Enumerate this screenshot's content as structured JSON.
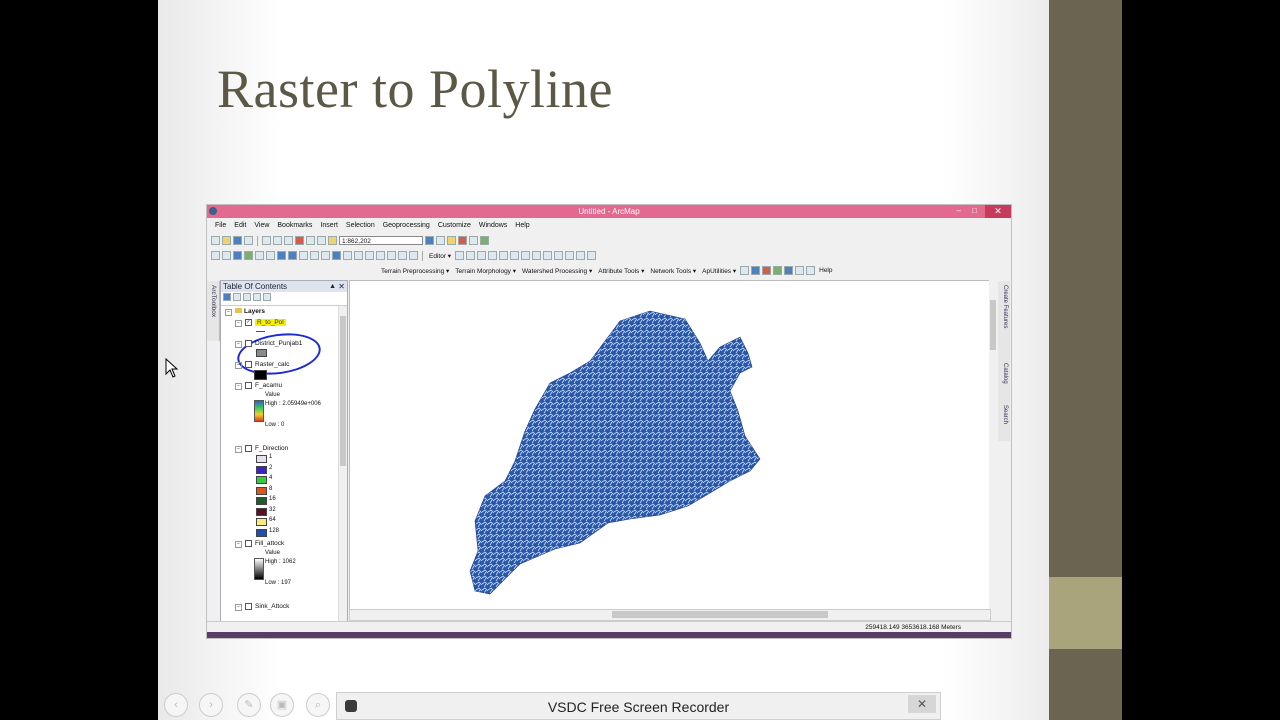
{
  "slide": {
    "title": "Raster to Polyline",
    "accent_color": "#6b6450",
    "accent_light": "#a9a47c",
    "title_color": "#5b5845"
  },
  "arcmap": {
    "window_title": "Untitled - ArcMap",
    "titlebar_color": "#e36a8e",
    "menu": [
      "File",
      "Edit",
      "View",
      "Bookmarks",
      "Insert",
      "Selection",
      "Geoprocessing",
      "Customize",
      "Windows",
      "Help"
    ],
    "scale_value": "1:862,202",
    "editor_label": "Editor ▾",
    "toolbar3": [
      "Terrain Preprocessing ▾",
      "Terrain Morphology ▾",
      "Watershed Processing ▾",
      "Attribute Tools ▾",
      "Network Tools ▾",
      "ApUtilities ▾",
      "Help"
    ],
    "left_tab": "ArcToolbox",
    "right_tabs": [
      "Create Features",
      "Catalog",
      "Search"
    ],
    "toc": {
      "title": "Table Of Contents",
      "root": "Layers",
      "layers": [
        {
          "name": "R_to_Pol",
          "checked": true
        },
        {
          "name": "District_Punjab1",
          "checked": false
        },
        {
          "name": "Raster_calc",
          "checked": false
        },
        {
          "name": "F_acamu",
          "checked": false,
          "value_label": "Value",
          "high": "High : 2.05949e+006",
          "low": "Low : 0"
        },
        {
          "name": "F_Direction",
          "checked": false,
          "classes": [
            "1",
            "2",
            "4",
            "8",
            "16",
            "32",
            "64",
            "128"
          ]
        },
        {
          "name": "Fill_attock",
          "checked": false,
          "value_label": "Value",
          "high": "High : 1062",
          "low": "Low : 197"
        },
        {
          "name": "Sink_Attock",
          "checked": false
        }
      ],
      "direction_colors": [
        "#e8e0f0",
        "#3b22c9",
        "#2fcf3f",
        "#e0531f",
        "#1e5c2a",
        "#5a1026",
        "#f5ef7a",
        "#1f4fb0"
      ]
    },
    "status_coords": "259418.149  3653618.168 Meters"
  },
  "recorder": {
    "title": "VSDC Free Screen Recorder",
    "close_label": "✕"
  },
  "controls": [
    "‹",
    "›",
    "✎",
    "▣",
    "⌕"
  ]
}
